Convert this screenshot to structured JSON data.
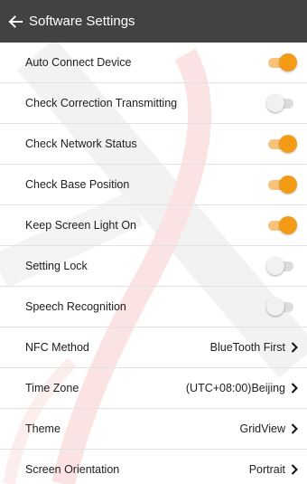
{
  "header": {
    "title": "Software Settings",
    "back_icon": "arrow-left-icon"
  },
  "colors": {
    "header_bg": "#424242",
    "toggle_on": "#f39b17",
    "toggle_off": "#f1f1f1"
  },
  "settings": [
    {
      "label": "Auto Connect Device",
      "type": "toggle",
      "on": true
    },
    {
      "label": "Check Correction Transmitting",
      "type": "toggle",
      "on": false
    },
    {
      "label": "Check Network Status",
      "type": "toggle",
      "on": true
    },
    {
      "label": "Check Base Position",
      "type": "toggle",
      "on": true
    },
    {
      "label": "Keep Screen Light On",
      "type": "toggle",
      "on": true
    },
    {
      "label": "Setting Lock",
      "type": "toggle",
      "on": false
    },
    {
      "label": "Speech Recognition",
      "type": "toggle",
      "on": false
    },
    {
      "label": "NFC Method",
      "type": "select",
      "value": "BlueTooth First"
    },
    {
      "label": "Time Zone",
      "type": "select",
      "value": "(UTC+08:00)Beijing"
    },
    {
      "label": "Theme",
      "type": "select",
      "value": "GridView"
    },
    {
      "label": "Screen Orientation",
      "type": "select",
      "value": "Portrait"
    }
  ]
}
